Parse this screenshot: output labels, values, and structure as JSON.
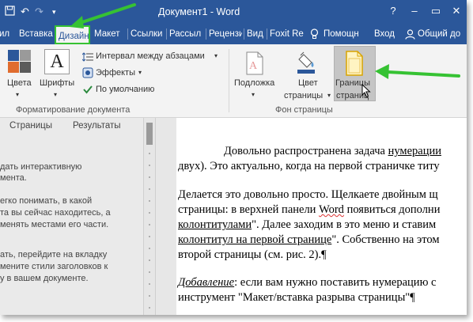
{
  "window": {
    "title": "Документ1 - Word",
    "controls": [
      "?",
      "–",
      "▭",
      "✕"
    ]
  },
  "ribbon_tabs": [
    "Вставка",
    "Дизайн",
    "Макет",
    "Ссылки",
    "Рассыл",
    "Рецензи",
    "Вид",
    "Foxit Re"
  ],
  "active_tab": "Дизайн",
  "tell_me": "Помощн",
  "signin": "Вход",
  "share": "Общий до",
  "ribbon": {
    "colors_label": "Цвета",
    "fonts_label": "Шрифты",
    "paragraph_spacing": "Интервал между абзацами",
    "effects": "Эффекты",
    "set_default": "По умолчанию",
    "group_formatting": "Форматирование документа",
    "watermark": "Подложка",
    "page_color_1": "Цвет",
    "page_color_2": "страницы",
    "page_borders_1": "Границы",
    "page_borders_2": "страниц",
    "group_background": "Фон страницы"
  },
  "nav": {
    "tabs": [
      "Страницы",
      "Результаты"
    ],
    "text_lines": [
      "дать интерактивную",
      "мента.",
      "",
      "егко понимать, в какой",
      "та вы сейчас находитесь, а",
      "менять местами его части.",
      "",
      "ать, перейдите на вкладку",
      "мените стили заголовков к",
      "у в вашем документе."
    ]
  },
  "doc": {
    "p1_a": "Довольно распространена задача ",
    "p1_u": "нумерации",
    "p1_line2": "двух). Это актуально, когда на первой страничке титу",
    "p2_line1": "Делается это довольно просто. Щелкаете двойным щ",
    "p2_line2a": "страницы: в верхней панели ",
    "p2_word": "Word",
    "p2_line2b": " появиться дополни",
    "p2_line3a": "колонтитулами",
    "p2_line3b": "\". Далее заходим в это меню и ставим",
    "p2_line4a": "колонтитул на первой странице",
    "p2_line4b": "\". Собственно на этом",
    "p2_line5": "второй страницы (см. рис. 2).¶",
    "p3_em": "Добавление",
    "p3_line1": ": если вам нужно поставить нумерацию с",
    "p3_line2": "инструмент \"Макет/вставка разрыва страницы\"¶"
  },
  "colors": {
    "titlebar": "#2b579a",
    "arrow": "#36c233",
    "ribbon_bg": "#f3f3f3"
  }
}
